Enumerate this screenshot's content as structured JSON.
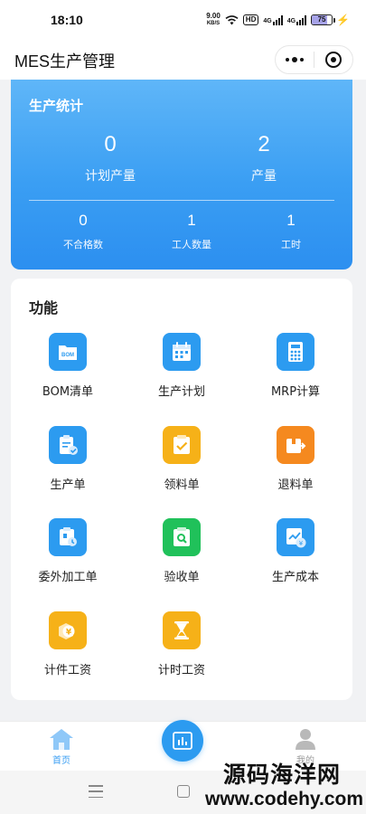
{
  "status_bar": {
    "time": "18:10",
    "net_speed_value": "9.00",
    "net_speed_unit": "KB/S",
    "hd_label": "HD",
    "network_1": "4G",
    "network_2": "4G",
    "battery_level": "75",
    "battery_percent": 75
  },
  "nav": {
    "title": "MES生产管理"
  },
  "stats": {
    "title": "生产统计",
    "planned_qty": {
      "value": "0",
      "label": "计划产量"
    },
    "output_qty": {
      "value": "2",
      "label": "产量"
    },
    "defect_count": {
      "value": "0",
      "label": "不合格数"
    },
    "worker_count": {
      "value": "1",
      "label": "工人数量"
    },
    "work_hours": {
      "value": "1",
      "label": "工时"
    }
  },
  "functions": {
    "title": "功能",
    "items": [
      {
        "label": "BOM清单",
        "icon": "bom-icon",
        "color": "#2c9bf0",
        "badge": "BOM"
      },
      {
        "label": "生产计划",
        "icon": "calendar-icon",
        "color": "#2c9bf0"
      },
      {
        "label": "MRP计算",
        "icon": "calculator-icon",
        "color": "#2c9bf0"
      },
      {
        "label": "生产单",
        "icon": "clipboard-check-icon",
        "color": "#2c9bf0"
      },
      {
        "label": "领料单",
        "icon": "material-pick-icon",
        "color": "#f6b118"
      },
      {
        "label": "退料单",
        "icon": "material-return-icon",
        "color": "#f5891f"
      },
      {
        "label": "委外加工单",
        "icon": "outsource-icon",
        "color": "#2c9bf0"
      },
      {
        "label": "验收单",
        "icon": "inspect-icon",
        "color": "#20c15a"
      },
      {
        "label": "生产成本",
        "icon": "cost-chart-icon",
        "color": "#2c9bf0"
      },
      {
        "label": "计件工资",
        "icon": "piece-wage-icon",
        "color": "#f6b118"
      },
      {
        "label": "计时工资",
        "icon": "hourglass-wage-icon",
        "color": "#f6b118"
      }
    ]
  },
  "tab_bar": {
    "home_label": "首页",
    "center_icon": "chart-icon",
    "mine_label": "我的",
    "active_color": "#3a9ef3"
  },
  "watermark": {
    "text_cn": "源码海洋网",
    "url": "www.codehy.com"
  }
}
